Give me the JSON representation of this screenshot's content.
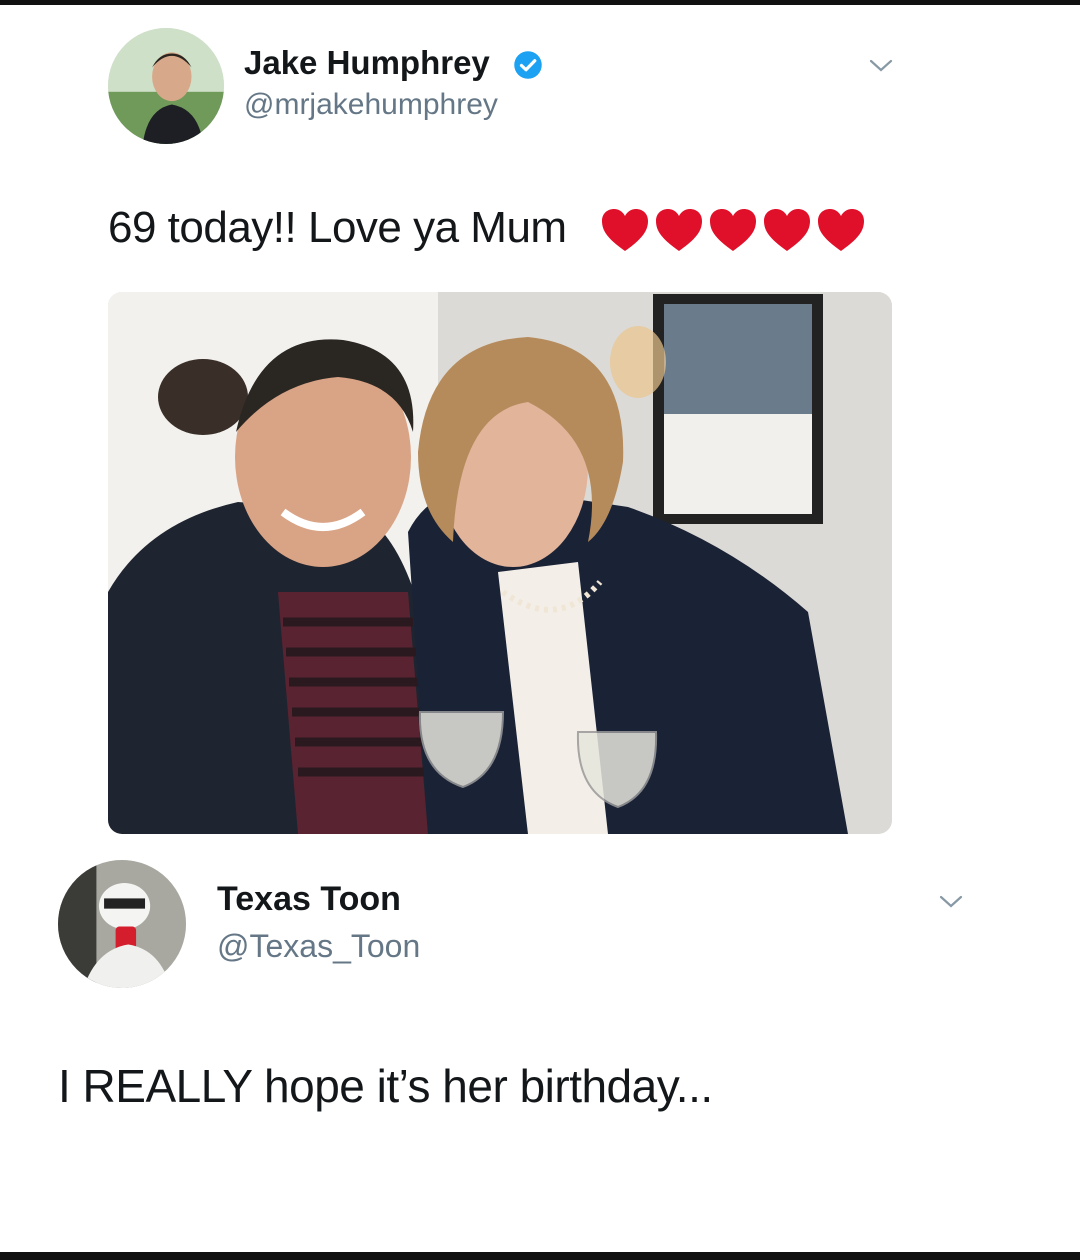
{
  "tweet": {
    "author_name": "Jake Humphrey",
    "author_handle": "@mrjakehumphrey",
    "verified": true,
    "text": "69 today!! Love ya Mum",
    "emoji": [
      "red-heart",
      "red-heart",
      "red-heart",
      "red-heart",
      "red-heart"
    ]
  },
  "reply": {
    "author_name": "Texas Toon",
    "author_handle": "@Texas_Toon",
    "text": "I REALLY hope it’s her birthday..."
  },
  "colors": {
    "verified_badge": "#1da1f2",
    "handle_text": "#657786",
    "heart": "#e0102a"
  }
}
